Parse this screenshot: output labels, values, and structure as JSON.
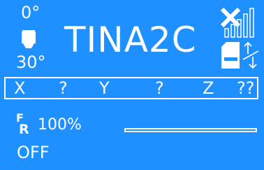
{
  "nozzle": {
    "target_temp": "0°",
    "current_temp": "30°",
    "icon": "nozzle-icon"
  },
  "printer_name": "TINA2C",
  "status_icons": {
    "wifi": "wifi-disconnected-icon",
    "sd_card": "sd-card-icon",
    "connection": "usb-connection-icon"
  },
  "axes": {
    "x_label": "X",
    "x_value": "?",
    "y_label": "Y",
    "y_value": "?",
    "z_label": "Z",
    "z_value": "??"
  },
  "feedrate": {
    "icon_big": "F",
    "icon_small": "R",
    "value": "100%"
  },
  "progress": {
    "value": 0
  },
  "status_text": "OFF",
  "colors": {
    "background": "#1E90FF",
    "foreground": "#FFFFFF"
  }
}
